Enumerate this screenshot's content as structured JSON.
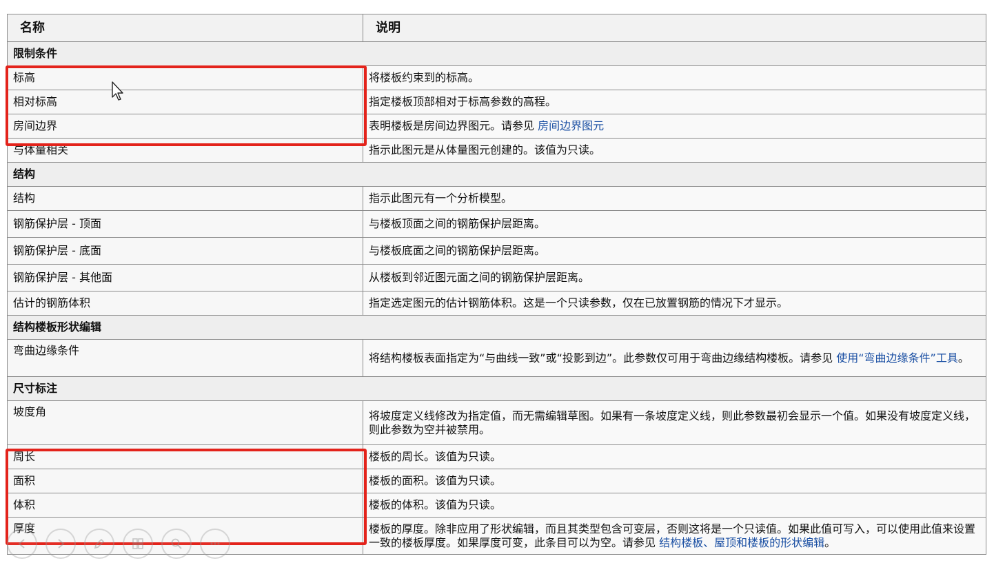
{
  "table": {
    "header": {
      "name": "名称",
      "description": "说明"
    },
    "sections": [
      {
        "title": "限制条件",
        "rows": [
          {
            "name": "标高",
            "description": "将楼板约束到的标高。"
          },
          {
            "name": "相对标高",
            "description": "指定楼板顶部相对于标高参数的高程。"
          },
          {
            "name": "房间边界",
            "description": "表明楼板是房间边界图元。请参见",
            "link": "房间边界图元"
          },
          {
            "name": "与体量相关",
            "description": "指示此图元是从体量图元创建的。该值为只读。"
          }
        ]
      },
      {
        "title": "结构",
        "rows": [
          {
            "name": "结构",
            "description": "指示此图元有一个分析模型。"
          },
          {
            "name": "钢筋保护层 - 顶面",
            "description": "与楼板顶面之间的钢筋保护层距离。"
          },
          {
            "name": "钢筋保护层 - 底面",
            "description": "与楼板底面之间的钢筋保护层距离。"
          },
          {
            "name": "钢筋保护层 - 其他面",
            "description": "从楼板到邻近图元面之间的钢筋保护层距离。"
          },
          {
            "name": "估计的钢筋体积",
            "description": "指定选定图元的估计钢筋体积。这是一个只读参数，仅在已放置钢筋的情况下才显示。"
          }
        ]
      },
      {
        "title": "结构楼板形状编辑",
        "rows": [
          {
            "name": "弯曲边缘条件",
            "description": "将结构楼板表面指定为“与曲线一致”或“投影到边”。此参数仅可用于弯曲边缘结构楼板。请参见",
            "link": "使用“弯曲边缘条件”工具",
            "suffix": "。"
          }
        ]
      },
      {
        "title": "尺寸标注",
        "rows": [
          {
            "name": "坡度角",
            "description": "将坡度定义线修改为指定值，而无需编辑草图。如果有一条坡度定义线，则此参数最初会显示一个值。如果没有坡度定义线，则此参数为空并被禁用。"
          },
          {
            "name": "周长",
            "description": "楼板的周长。该值为只读。"
          },
          {
            "name": "面积",
            "description": "楼板的面积。该值为只读。"
          },
          {
            "name": "体积",
            "description": "楼板的体积。该值为只读。"
          },
          {
            "name": "厚度",
            "description": "楼板的厚度。除非应用了形状编辑，而且其类型包含可变层，否则这将是一个只读值。如果此值可写入，可以使用此值来设置一致的楼板厚度。如果厚度可变，此条目可以为空。请参见",
            "link": "结构楼板、屋顶和楼板的形状编辑",
            "suffix": "。"
          }
        ]
      }
    ]
  },
  "colors": {
    "highlight": "#e3231b",
    "link": "#1a4fa3"
  },
  "player_controls": [
    {
      "icon": "previous-icon"
    },
    {
      "icon": "next-icon"
    },
    {
      "icon": "pen-icon"
    },
    {
      "icon": "slides-icon"
    },
    {
      "icon": "zoom-icon"
    },
    {
      "icon": "more-icon"
    }
  ]
}
